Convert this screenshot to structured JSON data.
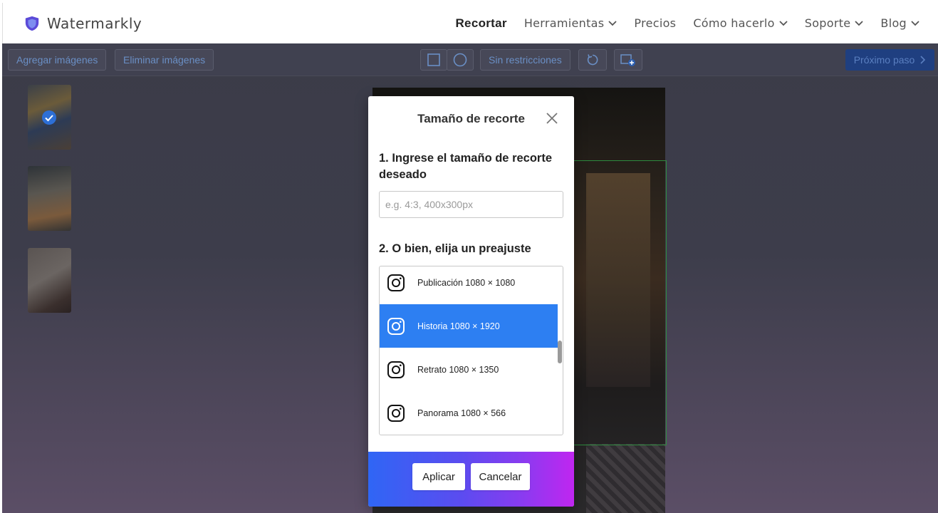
{
  "app": {
    "name": "Watermarkly"
  },
  "nav": {
    "items": [
      {
        "label": "Recortar",
        "active": true,
        "dropdown": false
      },
      {
        "label": "Herramientas",
        "active": false,
        "dropdown": true
      },
      {
        "label": "Precios",
        "active": false,
        "dropdown": false
      },
      {
        "label": "Cómo hacerlo",
        "active": false,
        "dropdown": true
      },
      {
        "label": "Soporte",
        "active": false,
        "dropdown": true
      },
      {
        "label": "Blog",
        "active": false,
        "dropdown": true
      }
    ]
  },
  "toolbar": {
    "add_images": "Agregar imágenes",
    "remove_images": "Eliminar imágenes",
    "no_restrictions": "Sin restricciones",
    "next_step": "Próximo paso"
  },
  "icons": {
    "logo": "shield-icon",
    "rect": "square-shape-icon",
    "circle": "circle-shape-icon",
    "rotate": "rotate-icon",
    "add_image": "image-add-icon",
    "check": "check-circle-icon",
    "close": "close-icon",
    "preset": "instagram-icon"
  },
  "colors": {
    "accent": "#2d7ff2",
    "logo": "#5b4ad8",
    "footer_start": "#2f66f5",
    "footer_end": "#c026f0"
  },
  "modal": {
    "title": "Tamaño de recorte",
    "step1": "1. Ingrese el tamaño de recorte deseado",
    "input_value": "",
    "input_placeholder": "e.g. 4:3, 400x300px",
    "step2": "2. O bien, elija un preajuste",
    "presets": [
      {
        "label": "Publicación 1080 × 1080",
        "selected": false
      },
      {
        "label": "Historia 1080 × 1920",
        "selected": true
      },
      {
        "label": "Retrato 1080 × 1350",
        "selected": false
      },
      {
        "label": "Panorama 1080 × 566",
        "selected": false
      }
    ],
    "apply": "Aplicar",
    "cancel": "Cancelar"
  }
}
